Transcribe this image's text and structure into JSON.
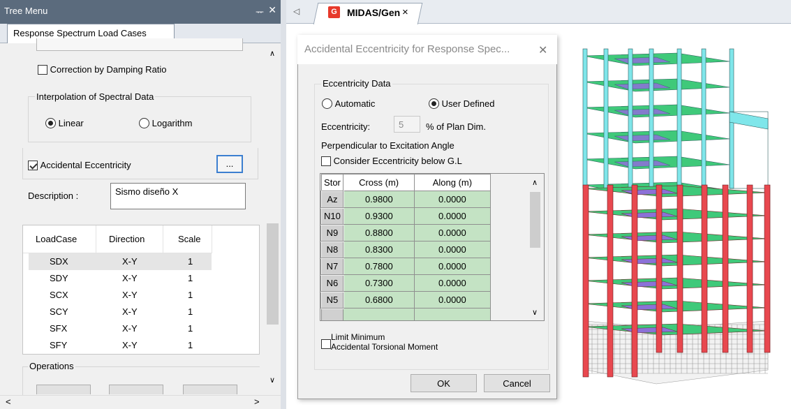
{
  "tree": {
    "title": "Tree Menu",
    "pin_glyph": "ᅲ",
    "close_glyph": "✕",
    "tab_label": "Response Spectrum Load Cases",
    "correction_label": "Correction by Damping Ratio",
    "correction_checked": false,
    "interp_group": "Interpolation of Spectral Data",
    "linear_label": "Linear",
    "log_label": "Logarithm",
    "interp_selected": "Linear",
    "accidental_label": "Accidental Eccentricity",
    "accidental_checked": true,
    "ellipsis_label": "...",
    "description_label": "Description :",
    "description_value": "Sismo diseño X",
    "loadcase_columns": [
      "LoadCase",
      "Direction",
      "Scale"
    ],
    "loadcases": [
      {
        "case": "SDX",
        "dir": "X-Y",
        "scale": "1"
      },
      {
        "case": "SDY",
        "dir": "X-Y",
        "scale": "1"
      },
      {
        "case": "SCX",
        "dir": "X-Y",
        "scale": "1"
      },
      {
        "case": "SCY",
        "dir": "X-Y",
        "scale": "1"
      },
      {
        "case": "SFX",
        "dir": "X-Y",
        "scale": "1"
      },
      {
        "case": "SFY",
        "dir": "X-Y",
        "scale": "1"
      }
    ],
    "operations_label": "Operations"
  },
  "doc": {
    "tab_label": "MIDAS/Gen",
    "tab_close": "×",
    "nav_left": "◁"
  },
  "dialog": {
    "title": "Accidental Eccentricity for Response Spec...",
    "close": "✕",
    "eccentricity_group": "Eccentricity Data",
    "automatic_label": "Automatic",
    "user_defined_label": "User Defined",
    "mode_selected": "User Defined",
    "eccentricity_label": "Eccentricity:",
    "eccentricity_value": "5",
    "eccentricity_unit": "% of Plan Dim.",
    "perpendicular_label": "Perpendicular to Excitation Angle",
    "consider_label": "Consider Eccentricity below G.L",
    "consider_checked": false,
    "columns": [
      "Stor",
      "Cross (m)",
      "Along (m)"
    ],
    "rows": [
      {
        "story": "Az",
        "cross": "0.9800",
        "along": "0.0000"
      },
      {
        "story": "N10",
        "cross": "0.9300",
        "along": "0.0000"
      },
      {
        "story": "N9",
        "cross": "0.8800",
        "along": "0.0000"
      },
      {
        "story": "N8",
        "cross": "0.8300",
        "along": "0.0000"
      },
      {
        "story": "N7",
        "cross": "0.7800",
        "along": "0.0000"
      },
      {
        "story": "N6",
        "cross": "0.7300",
        "along": "0.0000"
      },
      {
        "story": "N5",
        "cross": "0.6800",
        "along": "0.0000"
      }
    ],
    "limit_label_1": "Limit Minimum",
    "limit_label_2": "Accidental Torsional Moment",
    "limit_checked": false,
    "ok_label": "OK",
    "cancel_label": "Cancel"
  },
  "colors": {
    "titlebar": "#5b6b7d",
    "cell_green": "#c4e3c4",
    "column_red": "#e8484f",
    "slab_green": "#3fc97a",
    "frame_cyan": "#7fe6ea",
    "brace_purple": "#a05cf0"
  }
}
